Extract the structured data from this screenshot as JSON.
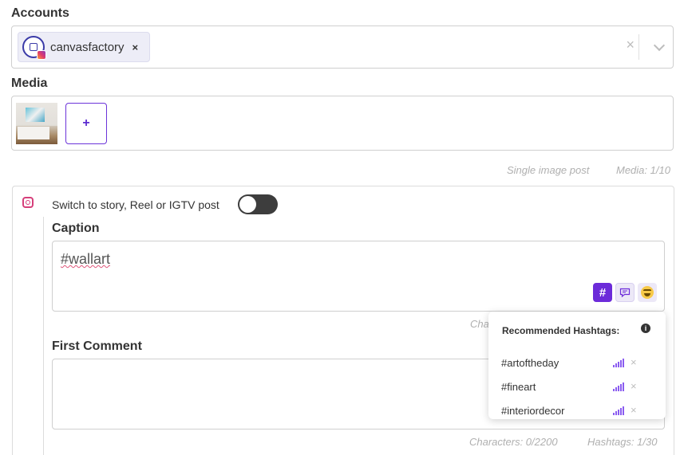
{
  "accounts": {
    "label": "Accounts",
    "selected": [
      {
        "name": "canvasfactory",
        "network": "instagram"
      }
    ],
    "remove_glyph": "×",
    "clear_glyph": "×"
  },
  "media": {
    "label": "Media",
    "add_label": "+",
    "type_info": "Single image post",
    "count_info": "Media: 1/10"
  },
  "post": {
    "network_icon": "instagram-icon",
    "switch_label": "Switch to story, Reel or IGTV post",
    "switch_on": false,
    "caption_label": "Caption",
    "caption_value": "#wallart",
    "caption_counter_partial": "Cha",
    "first_comment_label": "First Comment",
    "first_comment_value": "",
    "characters_info": "Characters: 0/2200",
    "hashtags_info": "Hashtags: 1/30"
  },
  "toolbar": {
    "hashtag_glyph": "#",
    "comment_icon": "speech-bubble-icon",
    "emoji_icon": "smile-emoji-icon"
  },
  "hashtag_popover": {
    "title": "Recommended Hashtags:",
    "info_glyph": "i",
    "remove_glyph": "×",
    "items": [
      {
        "tag": "#artoftheday"
      },
      {
        "tag": "#fineart"
      },
      {
        "tag": "#interiordecor"
      }
    ]
  },
  "colors": {
    "accent": "#6c2bd9",
    "border": "#cfcfcf",
    "toggle_off": "#3d3d3d",
    "meta_text": "#b0b0b0"
  }
}
